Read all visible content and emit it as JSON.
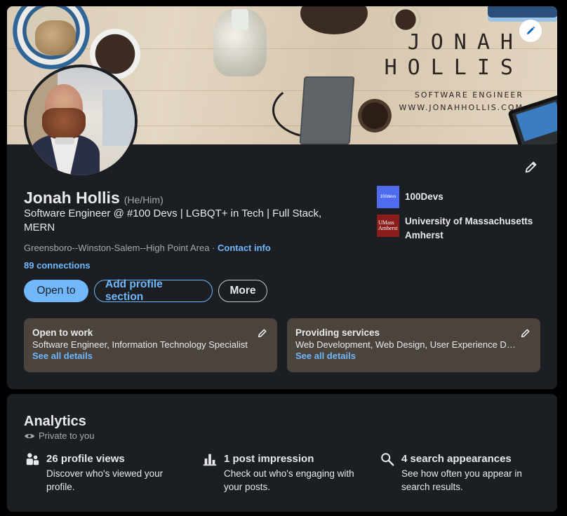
{
  "banner": {
    "name_line1": "JONAH",
    "name_line2": "HOLLIS",
    "title": "SOFTWARE ENGINEER",
    "website": "WWW.JONAHHOLLIS.COM"
  },
  "profile": {
    "name": "Jonah Hollis",
    "pronouns": "(He/Him)",
    "headline": "Software Engineer @ #100 Devs | LGBQT+ in Tech | Full Stack, MERN",
    "location": "Greensboro--Winston-Salem--High Point Area",
    "separator": " · ",
    "contact_info": "Contact info",
    "connections": "89 connections"
  },
  "organizations": [
    {
      "name": "100Devs",
      "logo_text": "100devs"
    },
    {
      "name": "University of Massachusetts Amherst",
      "logo_text_1": "UMass",
      "logo_text_2": "Amherst"
    }
  ],
  "buttons": {
    "open_to": "Open to",
    "add_section": "Add profile section",
    "more": "More"
  },
  "info_boxes": [
    {
      "title": "Open to work",
      "text": "Software Engineer, Information Technology Specialist",
      "link": "See all details"
    },
    {
      "title": "Providing services",
      "text": "Web Development, Web Design, User Experience Design",
      "link": "See all details"
    }
  ],
  "analytics": {
    "title": "Analytics",
    "privacy": "Private to you",
    "metrics": [
      {
        "title": "26 profile views",
        "desc": "Discover who's viewed your profile.",
        "icon": "people-icon"
      },
      {
        "title": "1 post impression",
        "desc": "Check out who's engaging with your posts.",
        "icon": "bar-chart-icon"
      },
      {
        "title": "4 search appearances",
        "desc": "See how often you appear in search results.",
        "icon": "search-icon"
      }
    ]
  },
  "colors": {
    "background": "#000000",
    "card": "#1b1f23",
    "accent": "#71b7fb",
    "info_box": "#4a443d"
  }
}
